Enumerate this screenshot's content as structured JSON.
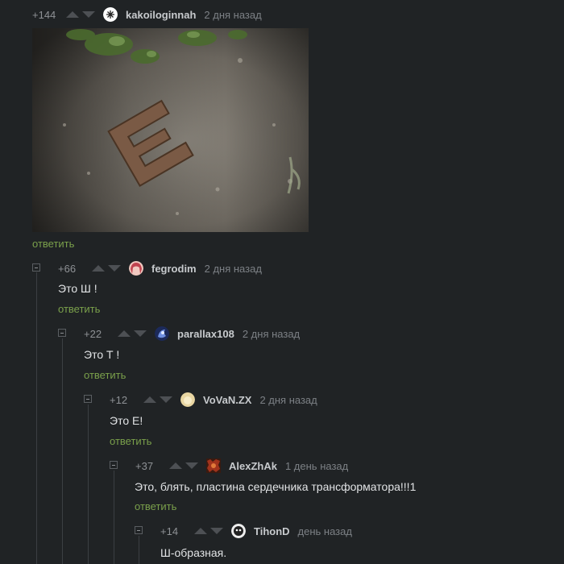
{
  "comments": [
    {
      "rating": "+144",
      "username": "kakoiloginnah",
      "time": "2 дня назад",
      "text": "",
      "reply": "ответить",
      "avatar_color": "#ffffff",
      "has_image": true
    },
    {
      "rating": "+66",
      "username": "fegrodim",
      "time": "2 дня назад",
      "text": "Это Ш !",
      "reply": "ответить",
      "avatar_color": "#c0434f"
    },
    {
      "rating": "+22",
      "username": "parallax108",
      "time": "2 дня назад",
      "text": "Это Т !",
      "reply": "ответить",
      "avatar_color": "#3c5bb8"
    },
    {
      "rating": "+12",
      "username": "VoVaN.ZX",
      "time": "2 дня назад",
      "text": "Это Е!",
      "reply": "ответить",
      "avatar_color": "#e9d6a2"
    },
    {
      "rating": "+37",
      "username": "AlexZhAk",
      "time": "1 день назад",
      "text": "Это, блять, пластина сердечника трансформатора!!!1",
      "reply": "ответить",
      "avatar_color": "#a0331c"
    },
    {
      "rating": "+14",
      "username": "TihonD",
      "time": "день назад",
      "text": "Ш-образная.",
      "reply": "",
      "avatar_color": "#eeeeee"
    }
  ],
  "icons": {
    "upvote": "arrow-up-icon",
    "downvote": "arrow-down-icon",
    "collapse": "minus-box-icon"
  }
}
